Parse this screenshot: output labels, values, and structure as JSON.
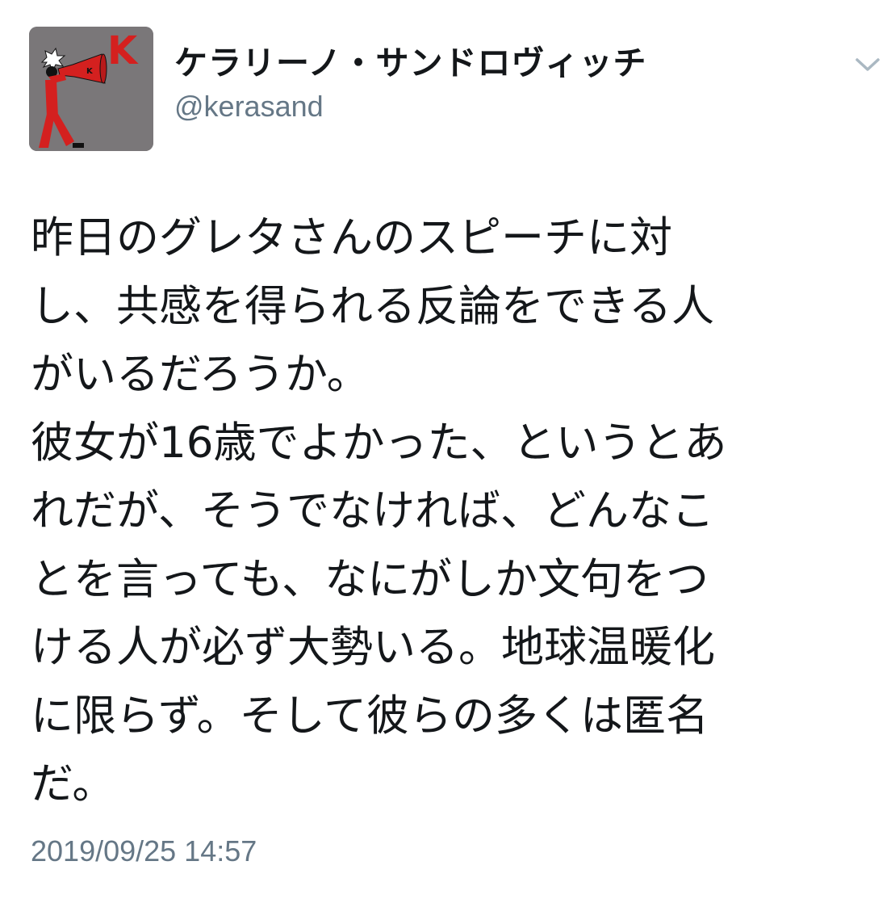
{
  "tweet": {
    "author": {
      "display_name": "ケラリーノ・サンドロヴィッチ",
      "handle": "@kerasand",
      "avatar_letter_large": "K",
      "avatar_letter_small": "K"
    },
    "lines": [
      "昨日のグレタさんのスピーチに対",
      "し、共感を得られる反論をできる人",
      "がいるだろうか。",
      "彼女が16歳でよかった、というとあ",
      "れだが、そうでなければ、どんなこ",
      "とを言っても、なにがしか文句をつ",
      "ける人が必ず大勢いる。地球温暖化",
      "に限らず。そして彼らの多くは匿名",
      "だ。"
    ],
    "timestamp": "2019/09/25 14:57"
  },
  "icons": {
    "menu": "chevron-down-icon",
    "avatar": "megaphone-figure-avatar-icon"
  },
  "colors": {
    "text": "#14171a",
    "secondary": "#657786",
    "avatar_background": "#7a7779",
    "avatar_red": "#d4201f",
    "caret": "#aab8c2"
  }
}
